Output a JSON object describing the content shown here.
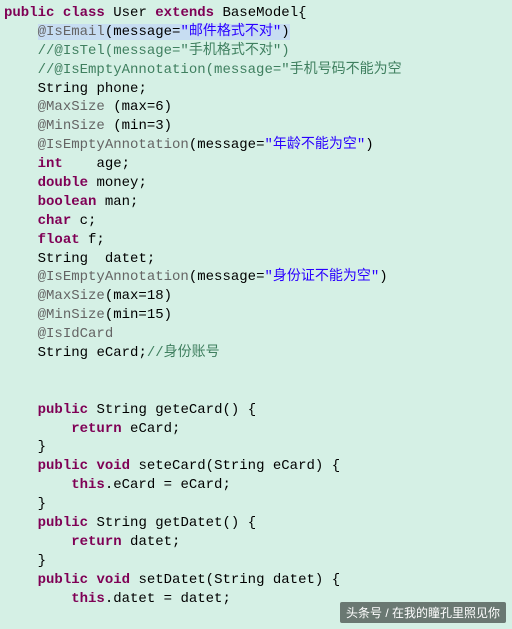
{
  "code": {
    "line1_public": "public",
    "line1_class": "class",
    "line1_User": "User",
    "line1_extends": "extends",
    "line1_Base": "BaseModel",
    "line1_brace": "{",
    "l2_ann": "@IsEmail",
    "l2_msg": "message",
    "l2_eq": "=",
    "l2_str": "\"邮件格式不对\"",
    "l3_com": "//@IsTel(message=\"手机格式不对\")",
    "l4_com": "//@IsEmptyAnnotation(message=\"手机号码不能为空",
    "l5_kw": "String",
    "l5_name": "phone;",
    "l6_ann": "@MaxSize",
    "l6_attr": "(max=6)",
    "l7_ann": "@MinSize",
    "l7_attr": "(min=3)",
    "l8_ann": "@IsEmptyAnnotation",
    "l8_msgkw": "message",
    "l8_str": "\"年龄不能为空\"",
    "l9_kw": "int",
    "l9_name": "age;",
    "l10_kw": "double",
    "l10_name": "money;",
    "l11_kw": "boolean",
    "l11_name": "man;",
    "l12_kw": "char",
    "l12_name": "c;",
    "l13_kw": "float",
    "l13_name": "f;",
    "l14_kw": "String",
    "l14_name": "datet;",
    "l15_ann": "@IsEmptyAnnotation",
    "l15_msgkw": "message",
    "l15_str": "\"身份证不能为空\"",
    "l16_ann": "@MaxSize",
    "l16_attr": "(max=18)",
    "l17_ann": "@MinSize",
    "l17_attr": "(min=15)",
    "l18_ann": "@IsIdCard",
    "l19_kw": "String",
    "l19_name": "eCard;",
    "l19_com": "//身份账号",
    "m1_sig1": "public",
    "m1_ret": "String",
    "m1_name": "geteCard()",
    "m1_ret_kw": "return",
    "m1_ret_v": "eCard;",
    "m2_ret": "void",
    "m2_name": "seteCard(String eCard)",
    "m2_this": "this",
    "m2_rest": ".eCard = eCard;",
    "m3_name": "getDatet()",
    "m3_ret_v": "datet;",
    "m4_name": "setDatet(String datet)",
    "m4_rest": ".datet = datet;"
  },
  "watermark": "头条号 / 在我的瞳孔里照见你"
}
